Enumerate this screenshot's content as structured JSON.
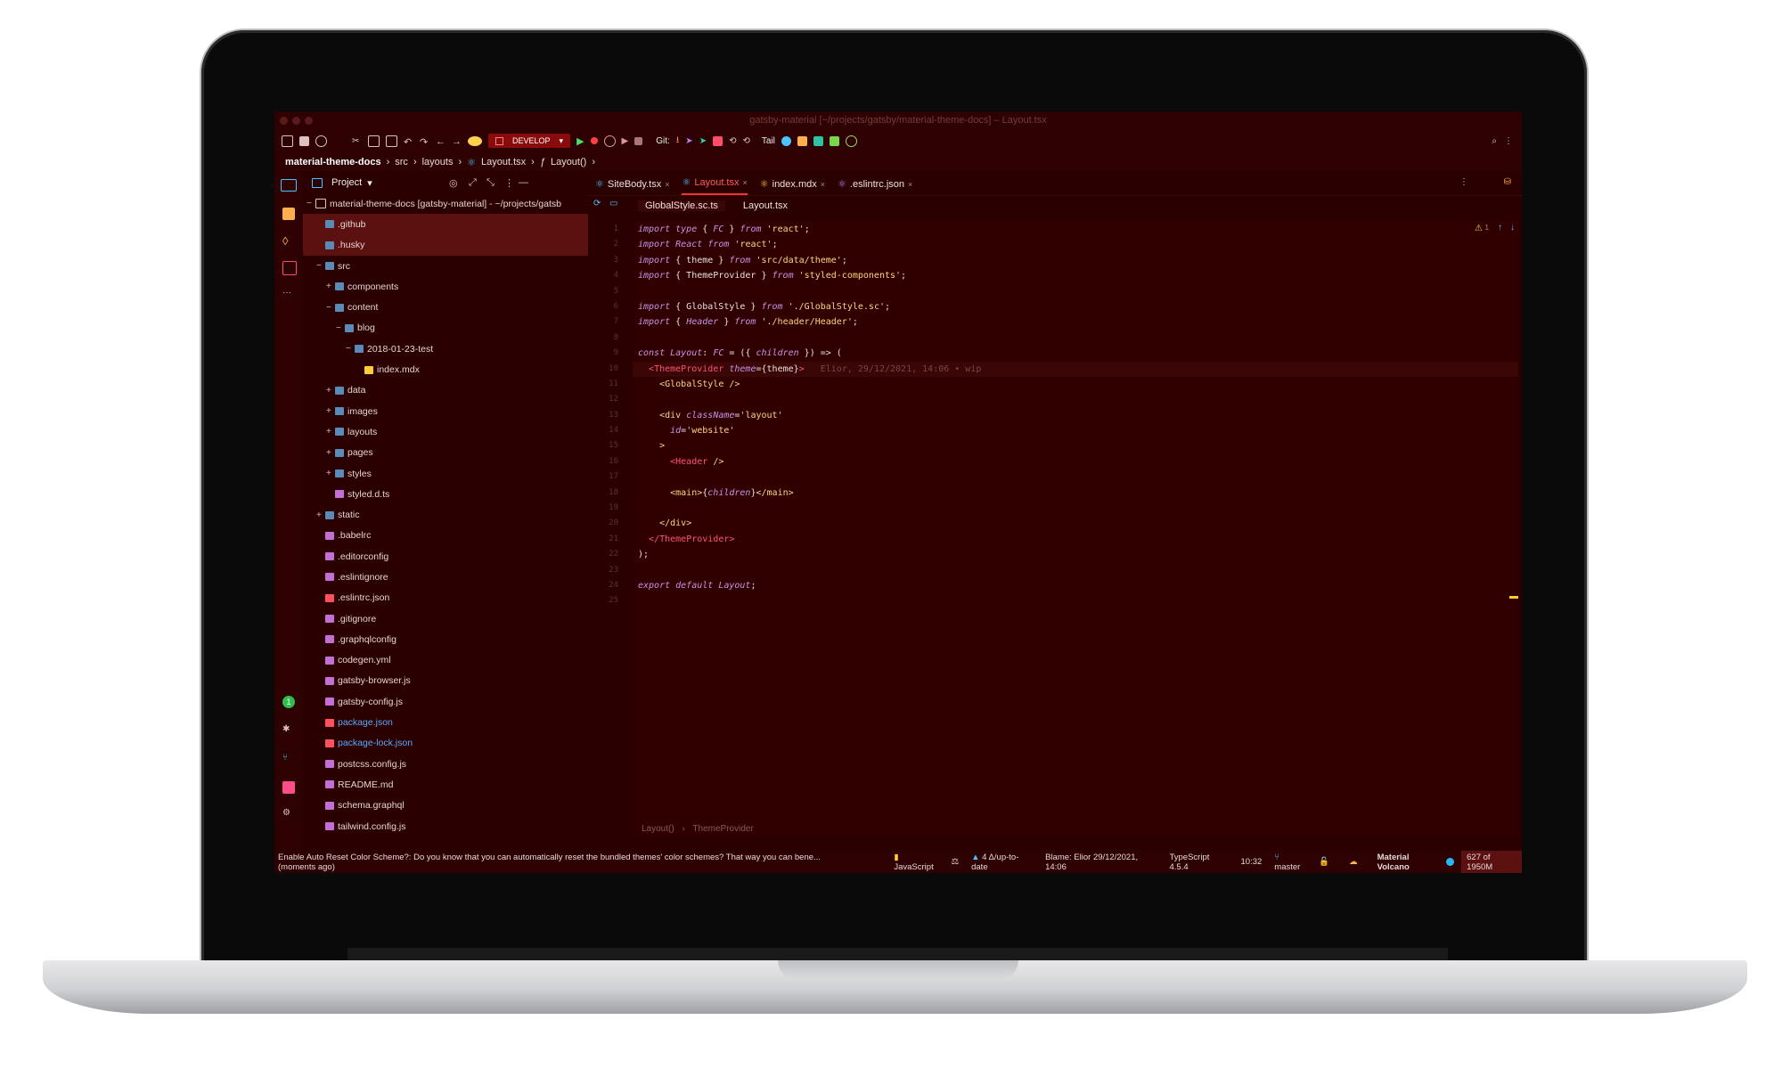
{
  "window": {
    "title": "gatsby-material [~/projects/gatsby/material-theme-docs] – Layout.tsx"
  },
  "toolbar": {
    "run_config": "DEVELOP",
    "git_label": "Git:",
    "tail_label": "Tail"
  },
  "breadcrumb": [
    "material-theme-docs",
    "src",
    "layouts",
    "Layout.tsx",
    "Layout()"
  ],
  "project_panel": {
    "title": "Project",
    "root": "material-theme-docs [gatsby-material] - ~/projects/gatsb",
    "items": [
      {
        "label": ".github",
        "depth": 1,
        "toggle": "",
        "selected": true
      },
      {
        "label": ".husky",
        "depth": 1,
        "toggle": "",
        "selected": true
      },
      {
        "label": "src",
        "depth": 1,
        "toggle": "−"
      },
      {
        "label": "components",
        "depth": 2,
        "toggle": "+"
      },
      {
        "label": "content",
        "depth": 2,
        "toggle": "−"
      },
      {
        "label": "blog",
        "depth": 3,
        "toggle": "−"
      },
      {
        "label": "2018-01-23-test",
        "depth": 4,
        "toggle": "−"
      },
      {
        "label": "index.mdx",
        "depth": 5,
        "toggle": ""
      },
      {
        "label": "data",
        "depth": 2,
        "toggle": "+"
      },
      {
        "label": "images",
        "depth": 2,
        "toggle": "+"
      },
      {
        "label": "layouts",
        "depth": 2,
        "toggle": "+"
      },
      {
        "label": "pages",
        "depth": 2,
        "toggle": "+"
      },
      {
        "label": "styles",
        "depth": 2,
        "toggle": "+"
      },
      {
        "label": "styled.d.ts",
        "depth": 2,
        "toggle": ""
      },
      {
        "label": "static",
        "depth": 1,
        "toggle": "+"
      },
      {
        "label": ".babelrc",
        "depth": 1,
        "toggle": ""
      },
      {
        "label": ".editorconfig",
        "depth": 1,
        "toggle": ""
      },
      {
        "label": ".eslintignore",
        "depth": 1,
        "toggle": ""
      },
      {
        "label": ".eslintrc.json",
        "depth": 1,
        "toggle": ""
      },
      {
        "label": ".gitignore",
        "depth": 1,
        "toggle": ""
      },
      {
        "label": ".graphqlconfig",
        "depth": 1,
        "toggle": ""
      },
      {
        "label": "codegen.yml",
        "depth": 1,
        "toggle": ""
      },
      {
        "label": "gatsby-browser.js",
        "depth": 1,
        "toggle": ""
      },
      {
        "label": "gatsby-config.js",
        "depth": 1,
        "toggle": ""
      },
      {
        "label": "package.json",
        "depth": 1,
        "toggle": "",
        "blue": true
      },
      {
        "label": "package-lock.json",
        "depth": 1,
        "toggle": "",
        "blue": true
      },
      {
        "label": "postcss.config.js",
        "depth": 1,
        "toggle": ""
      },
      {
        "label": "README.md",
        "depth": 1,
        "toggle": ""
      },
      {
        "label": "schema.graphql",
        "depth": 1,
        "toggle": ""
      },
      {
        "label": "tailwind.config.js",
        "depth": 1,
        "toggle": ""
      }
    ]
  },
  "editor": {
    "tabs": [
      {
        "label": "SiteBody.tsx",
        "active": false
      },
      {
        "label": "Layout.tsx",
        "active": true
      },
      {
        "label": "index.mdx",
        "active": false
      },
      {
        "label": ".eslintrc.json",
        "active": false
      }
    ],
    "subtabs": [
      {
        "label": "GlobalStyle.sc.ts",
        "active": true
      },
      {
        "label": "Layout.tsx",
        "active": false
      }
    ],
    "blame_annotation": "Elior, 29/12/2021, 14:06 • wip",
    "inspection_count": "1",
    "bottom_breadcrumb": [
      "Layout()",
      "ThemeProvider"
    ]
  },
  "status_bar": {
    "message": "Enable Auto Reset Color Scheme?: Do you know that you can automatically reset the bundled themes' color schemes? That way you can bene... (moments ago)",
    "language": "JavaScript",
    "vcs_status": "4 Δ/up-to-date",
    "blame": "Blame: Elior 29/12/2021, 14:06",
    "typescript": "TypeScript 4.5.4",
    "position": "10:32",
    "branch": "master",
    "theme": "Material Volcano",
    "memory": "627 of 1950M"
  },
  "tool_window_badge": "1",
  "colors": {
    "accent": "#ff3030",
    "background": "#2a0000",
    "selection": "#5c1111"
  }
}
